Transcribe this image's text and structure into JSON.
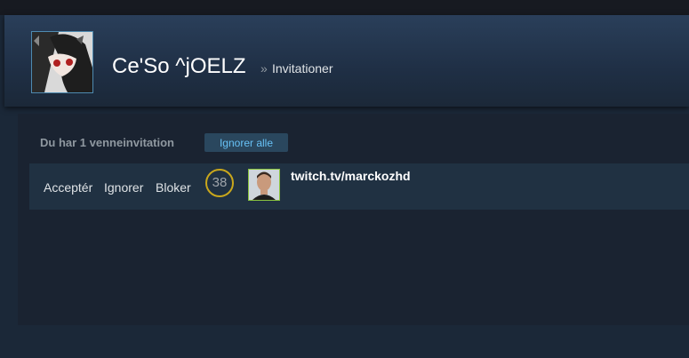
{
  "profile": {
    "name": "Ce'So ^jOELZ",
    "breadcrumb_sep": "»",
    "page": "Invitationer"
  },
  "invites": {
    "summary": "Du har 1 venneinvitation",
    "ignore_all_label": "Ignorer alle",
    "items": [
      {
        "accept_label": "Acceptér",
        "ignore_label": "Ignorer",
        "block_label": "Bloker",
        "level": "38",
        "name": "twitch.tv/marckozhd"
      }
    ]
  },
  "colors": {
    "background": "#1b2838",
    "accent": "#67c1f5",
    "level_ring": "#c9a71c",
    "online_border": "#8bc53f"
  }
}
